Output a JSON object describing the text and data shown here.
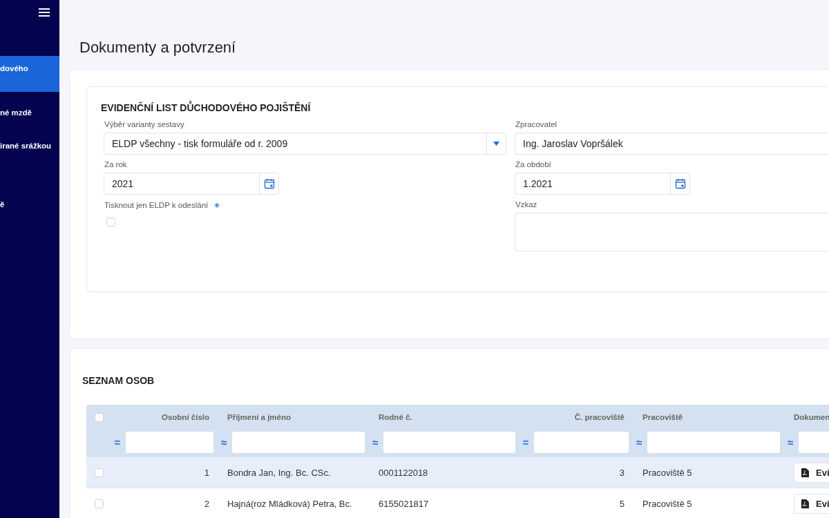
{
  "sidebar": {
    "items": [
      {
        "label": "dového",
        "selected": true
      },
      {
        "label": "né mzdě",
        "selected": false
      },
      {
        "label": "irané srážkou",
        "selected": false
      },
      {
        "label": "ě",
        "selected": false
      }
    ]
  },
  "page_title": "Dokumenty a potvrzení",
  "form": {
    "title": "EVIDENČNÍ LIST DŮCHODOVÉHO POJIŠTĚNÍ",
    "fields": [
      {
        "kind": "select",
        "label": "Výběr varianty sestavy",
        "value": "ELDP všechny - tisk formuláře od r. 2009"
      },
      {
        "kind": "text",
        "label": "Zpracovatel",
        "value": "Ing. Jaroslav Vopršálek"
      },
      {
        "kind": "date",
        "label": "Za rok",
        "value": "2021"
      },
      {
        "kind": "date",
        "label": "Za období",
        "value": "1.2021"
      },
      {
        "kind": "checkbox",
        "label": "Tisknout jen ELDP k odeslání",
        "required_mark": "∗",
        "checked": false
      },
      {
        "kind": "textarea",
        "label": "Vzkaz"
      }
    ]
  },
  "people": {
    "title": "SEZNAM OSOB",
    "select_all": {
      "checked": false
    },
    "columns": [
      {
        "label": "Osobní číslo",
        "operator": "=",
        "kind": "number"
      },
      {
        "label": "Příjmení a jméno",
        "operator": "≈",
        "kind": "text"
      },
      {
        "label": "Rodné č.",
        "operator": "≈",
        "kind": "text"
      },
      {
        "label": "Č. pracoviště",
        "operator": "=",
        "kind": "number"
      },
      {
        "label": "Pracoviště",
        "operator": "≈",
        "kind": "text"
      },
      {
        "label": "Dokumen",
        "operator": "≈",
        "kind": "text"
      }
    ],
    "rows": [
      {
        "selected": false,
        "highlighted": true,
        "cells": [
          "1",
          "Bondra Jan, Ing. Bc. CSc.",
          "0001122018",
          "3",
          "Pracoviště 5"
        ],
        "document": "Evi"
      },
      {
        "selected": false,
        "highlighted": false,
        "cells": [
          "2",
          "Hajná(roz Mládková) Petra, Bc.",
          "6155021817",
          "5",
          "Pracoviště 5"
        ],
        "document": "Evi"
      }
    ]
  }
}
